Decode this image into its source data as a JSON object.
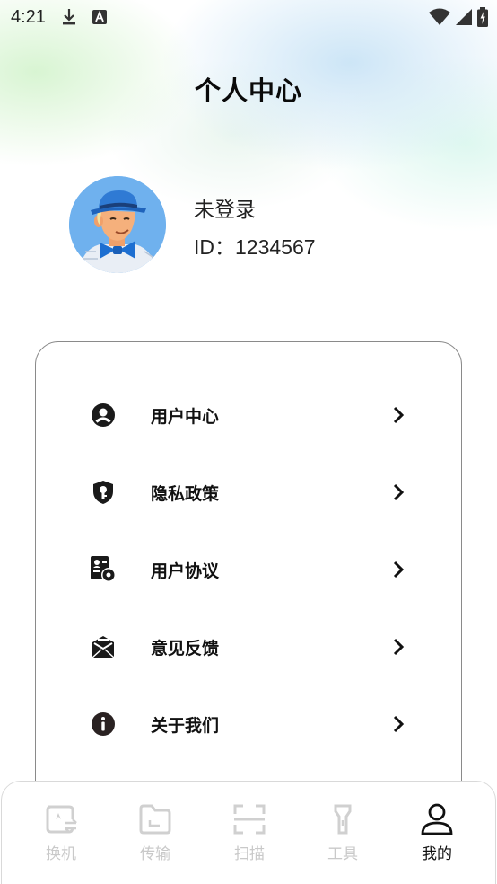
{
  "status_bar": {
    "time": "4:21",
    "left_icons": [
      "download-icon",
      "text-a-icon"
    ],
    "right_icons": [
      "wifi-icon",
      "signal-icon",
      "battery-icon"
    ]
  },
  "header": {
    "title": "个人中心"
  },
  "profile": {
    "avatar": "avatar-illustration",
    "name": "未登录",
    "id_label": "ID：1234567"
  },
  "menu": {
    "items": [
      {
        "label": "用户中心",
        "icon": "user-circle-icon"
      },
      {
        "label": "隐私政策",
        "icon": "shield-key-icon"
      },
      {
        "label": "用户协议",
        "icon": "agreement-gear-icon"
      },
      {
        "label": "意见反馈",
        "icon": "mail-edit-icon"
      },
      {
        "label": "关于我们",
        "icon": "info-icon"
      }
    ]
  },
  "tabbar": {
    "tabs": [
      {
        "label": "换机",
        "icon": "phone-switch-icon",
        "active": false
      },
      {
        "label": "传输",
        "icon": "folder-transfer-icon",
        "active": false
      },
      {
        "label": "扫描",
        "icon": "scan-icon",
        "active": false
      },
      {
        "label": "工具",
        "icon": "flashlight-icon",
        "active": false
      },
      {
        "label": "我的",
        "icon": "person-icon",
        "active": true
      }
    ]
  },
  "colors": {
    "accent": "#111111",
    "inactive": "#c9c9c9",
    "card_border": "#8a8a8a",
    "avatar_bg": "#6fb1ee"
  }
}
